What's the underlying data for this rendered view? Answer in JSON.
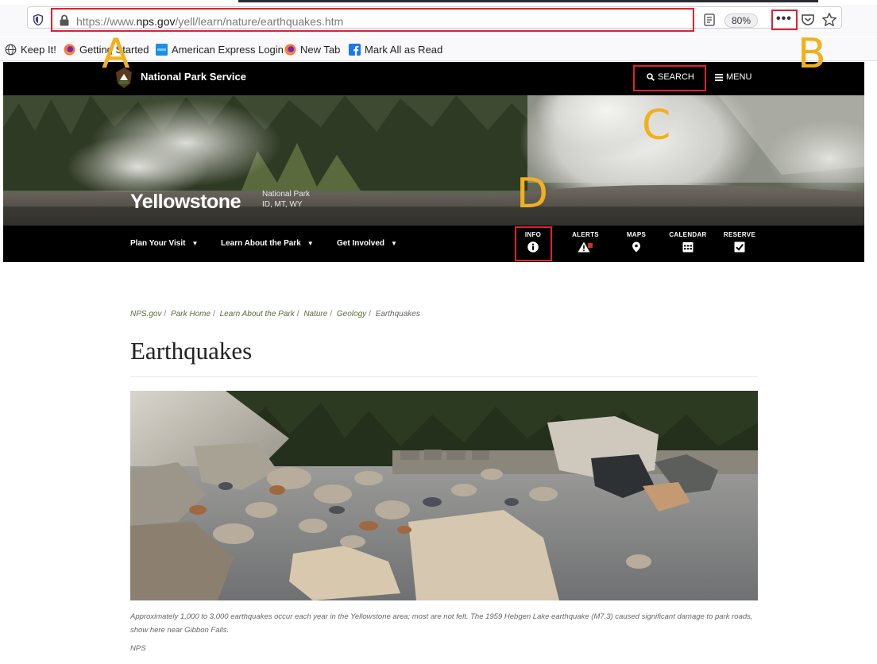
{
  "browser": {
    "url_prefix": "https://www.",
    "url_domain": "nps.gov",
    "url_path": "/yell/learn/nature/earthquakes.htm",
    "zoom": "80%",
    "menu_dots": "•••"
  },
  "bookmarks": [
    {
      "label": "Keep It!",
      "icon": "globe-icon"
    },
    {
      "label": "Getting Started",
      "icon": "firefox-icon"
    },
    {
      "label": "American Express Login",
      "icon": "amex-icon"
    },
    {
      "label": "New Tab",
      "icon": "firefox-icon"
    },
    {
      "label": "Mark All as Read",
      "icon": "facebook-icon"
    }
  ],
  "annotations": {
    "a": "A",
    "b": "B",
    "c": "C",
    "d": "D"
  },
  "header": {
    "org": "National Park Service",
    "search": "SEARCH",
    "menu": "MENU"
  },
  "park": {
    "name": "Yellowstone",
    "type": "National Park",
    "states": "ID, MT, WY"
  },
  "nav": {
    "items": [
      "Plan Your Visit",
      "Learn About the Park",
      "Get Involved"
    ],
    "quick": [
      "INFO",
      "ALERTS",
      "MAPS",
      "CALENDAR",
      "RESERVE"
    ]
  },
  "breadcrumb": [
    "NPS.gov",
    "Park Home",
    "Learn About the Park",
    "Nature",
    "Geology",
    "Earthquakes"
  ],
  "page": {
    "title": "Earthquakes",
    "caption": "Approximately 1,000 to 3,000 earthquakes occur each year in the Yellowstone area; most are not felt. The 1959 Hebgen Lake earthquake (M7.3) caused significant damage to park roads, show here near Gibbon Falls.",
    "credit": "NPS"
  }
}
